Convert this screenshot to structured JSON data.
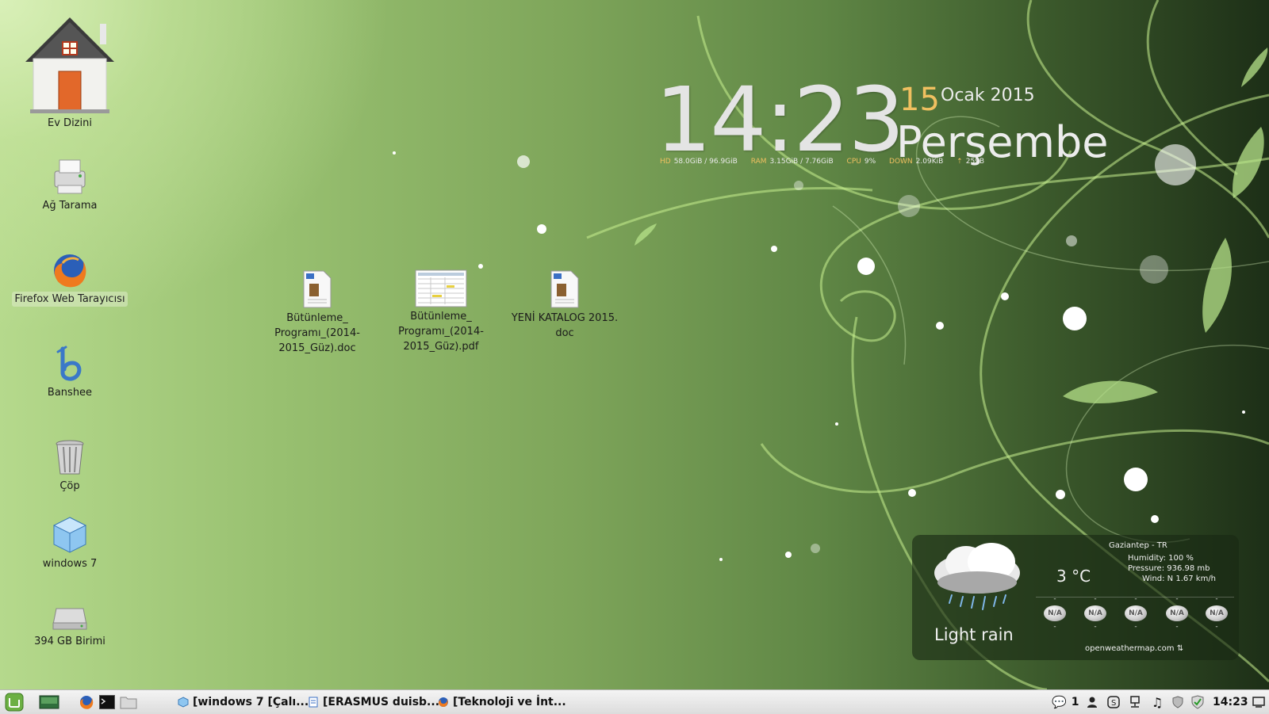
{
  "desktop": {
    "icons": [
      {
        "label": "Ev Dizini",
        "icon": "home-folder-icon"
      },
      {
        "label": "Ağ Tarama",
        "icon": "network-printer-icon"
      },
      {
        "label": "Firefox Web Tarayıcısı",
        "icon": "firefox-icon"
      },
      {
        "label": "Banshee",
        "icon": "banshee-icon"
      },
      {
        "label": "Çöp",
        "icon": "trash-icon"
      },
      {
        "label": "windows 7",
        "icon": "virtualbox-icon"
      },
      {
        "label": "394 GB Birimi",
        "icon": "hard-drive-icon"
      }
    ],
    "files": [
      {
        "label": "Bütünleme_ Programı_(2014- 2015_Güz).doc",
        "icon": "doc-file-icon"
      },
      {
        "label": "Bütünleme_ Programı_(2014- 2015_Güz).pdf",
        "icon": "pdf-file-icon"
      },
      {
        "label": "YENİ KATALOG 2015. doc",
        "icon": "doc-file-icon"
      }
    ]
  },
  "clock": {
    "time": "14:23",
    "day": "15",
    "month_year": "Ocak 2015",
    "weekday": "Perşembe"
  },
  "sysinfo": {
    "hd_label": "HD",
    "hd_value": "58.0GiB / 96.9GiB",
    "ram_label": "RAM",
    "ram_value": "3.15GiB / 7.76GiB",
    "cpu_label": "CPU",
    "cpu_value": "9%",
    "down_label": "DOWN",
    "down_value": "2.09KiB",
    "up_value": "259B"
  },
  "weather": {
    "city": "Gaziantep - TR",
    "humidity": "Humidity: 100 %",
    "pressure": "Pressure: 936.98 mb",
    "wind": "Wind: N 1.67 km/h",
    "temperature": "3 °C",
    "condition": "Light rain",
    "source": "openweathermap.com",
    "forecast_top": [
      "-",
      "-",
      "-",
      "-",
      "-"
    ],
    "forecast_na": [
      "N/A",
      "N/A",
      "N/A",
      "N/A",
      "N/A"
    ],
    "forecast_bottom": [
      "-",
      "-",
      "-",
      "-",
      "-"
    ]
  },
  "taskbar": {
    "tasks": [
      {
        "label": "[windows 7 [Çalı...",
        "icon": "virtualbox-icon"
      },
      {
        "label": "[ERASMUS duisb...",
        "icon": "document-icon"
      },
      {
        "label": "[Teknoloji ve İnt...",
        "icon": "firefox-icon"
      }
    ],
    "message_count": "1",
    "time": "14:23"
  },
  "colors": {
    "accent": "#f0c060",
    "taskbar_bg": "#e6e6e6",
    "weather_bg": "#1c2c17"
  }
}
